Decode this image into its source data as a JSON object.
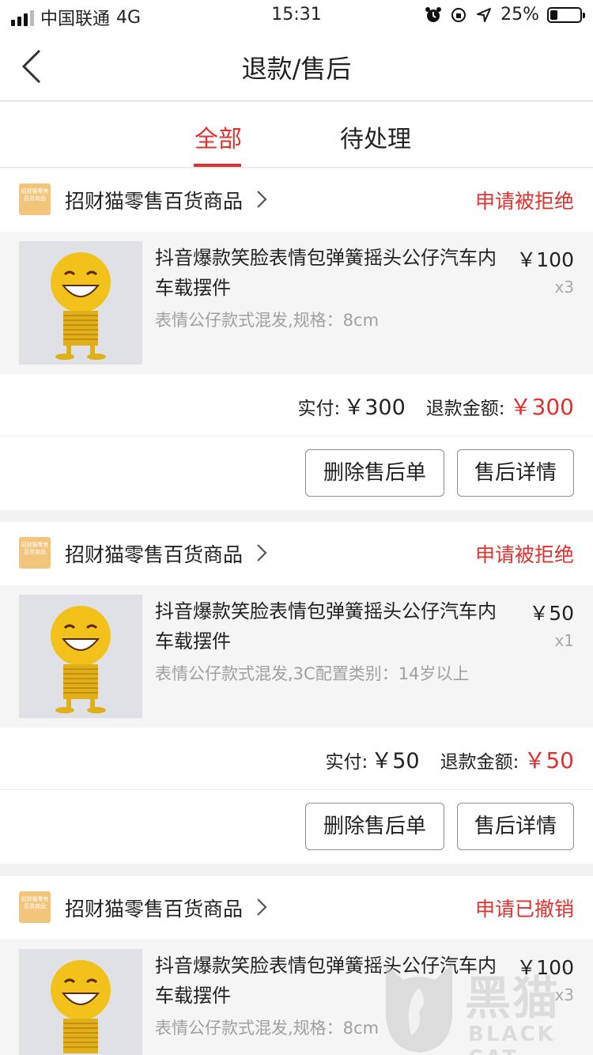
{
  "status_bar": {
    "carrier": "中国联通",
    "network": "4G",
    "time": "15:31",
    "battery": "25%",
    "battery_level": 0.25
  },
  "nav": {
    "title": "退款/售后",
    "back_icon": "chevron-left-icon"
  },
  "tabs": [
    {
      "label": "全部",
      "active": true
    },
    {
      "label": "待处理",
      "active": false
    }
  ],
  "orders": [
    {
      "shop_name": "招财猫零售百货商品",
      "shop_logo_text": "招财猫零售百货商品",
      "status": "申请被拒绝",
      "product_title": "抖音爆款笑脸表情包弹簧摇头公仔汽车内车载摆件",
      "product_spec": "表情公仔款式混发,规格：8cm",
      "price": "￥100",
      "qty": "x3",
      "paid_label": "实付:",
      "paid_amount": "￥300",
      "refund_label": "退款金额:",
      "refund_amount": "￥300",
      "delete_label": "删除售后单",
      "detail_label": "售后详情"
    },
    {
      "shop_name": "招财猫零售百货商品",
      "shop_logo_text": "招财猫零售百货商品",
      "status": "申请被拒绝",
      "product_title": "抖音爆款笑脸表情包弹簧摇头公仔汽车内车载摆件",
      "product_spec": "表情公仔款式混发,3C配置类别：14岁以上",
      "price": "￥50",
      "qty": "x1",
      "paid_label": "实付:",
      "paid_amount": "￥50",
      "refund_label": "退款金额:",
      "refund_amount": "￥50",
      "delete_label": "删除售后单",
      "detail_label": "售后详情"
    },
    {
      "shop_name": "招财猫零售百货商品",
      "shop_logo_text": "招财猫零售百货商品",
      "status": "申请已撤销",
      "product_title": "抖音爆款笑脸表情包弹簧摇头公仔汽车内车载摆件",
      "product_spec": "表情公仔款式混发,规格：8cm",
      "price": "￥100",
      "qty": "x3"
    }
  ],
  "watermark": {
    "cn": "黑猫",
    "en": "BLACK CAT"
  },
  "colors": {
    "accent_red": "#e0312f",
    "shop_logo_bg": "#f3c57a"
  }
}
